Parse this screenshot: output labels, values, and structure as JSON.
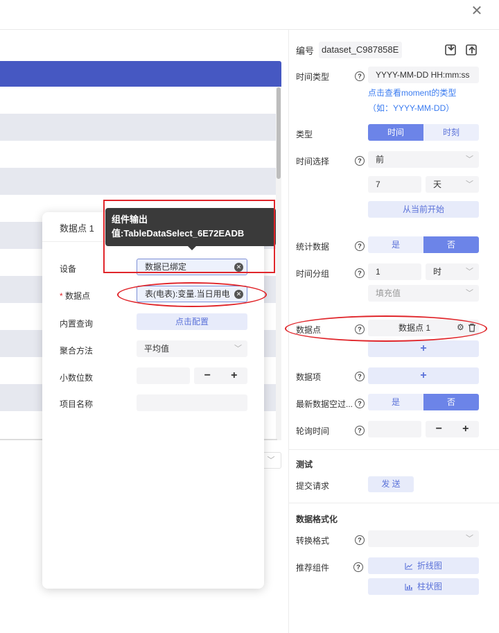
{
  "window": {
    "close_icon": "close-icon"
  },
  "right": {
    "code_label": "编号",
    "code_value": "dataset_C987858E",
    "time_type_label": "时间类型",
    "time_type_value": "YYYY-MM-DD HH:mm:ss",
    "moment_link": "点击查看moment的类型",
    "moment_example": "（如：YYYY-MM-DD）",
    "type_label": "类型",
    "type_options": [
      "时间",
      "时刻"
    ],
    "time_select_label": "时间选择",
    "time_select_value": "前",
    "time_count": "7",
    "time_unit": "天",
    "from_now_button": "从当前开始",
    "stat_label": "统计数据",
    "stat_options": [
      "是",
      "否"
    ],
    "group_label": "时间分组",
    "group_value": "1",
    "group_unit": "时",
    "fill_placeholder": "填充值",
    "datapoint_label": "数据点",
    "datapoint_item": "数据点 1",
    "add_symbol": "+",
    "dataitem_label": "数据项",
    "latest_empty_label": "最新数据空过...",
    "latest_options": [
      "是",
      "否"
    ],
    "poll_label": "轮询时间",
    "stepper_minus": "−",
    "stepper_plus": "+",
    "test_title": "测试",
    "submit_label": "提交请求",
    "send_button": "发 送",
    "format_title": "数据格式化",
    "convert_label": "转换格式",
    "recommend_label": "推荐组件",
    "line_chart_button": "折线图",
    "bar_chart_button": "柱状图"
  },
  "popup": {
    "title": "数据点 1",
    "tooltip_line1": "组件输出",
    "tooltip_line2": "值:TableDataSelect_6E72EADB",
    "device_label": "设备",
    "device_value": "数据已绑定",
    "required_mark": "*",
    "datapoint_label": "数据点",
    "datapoint_value": "表(电表):变量.当日用电",
    "query_label": "内置查询",
    "query_button": "点击配置",
    "agg_label": "聚合方法",
    "agg_value": "平均值",
    "decimal_label": "小数位数",
    "name_label": "项目名称"
  },
  "colors": {
    "accent": "#6c84e8",
    "header_blue": "#4658c2",
    "annotation_red": "#e0262b",
    "link_blue": "#3b7cf0"
  }
}
